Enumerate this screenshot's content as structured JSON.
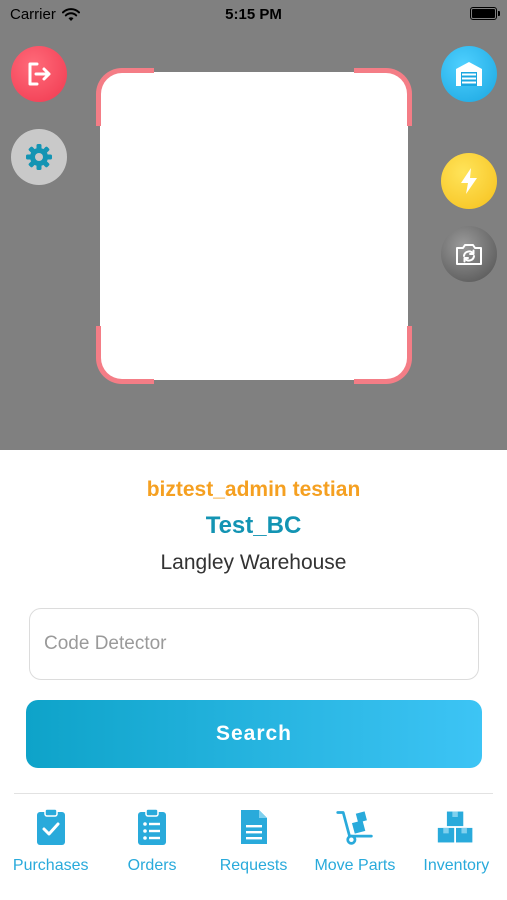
{
  "status_bar": {
    "carrier": "Carrier",
    "time": "5:15 PM"
  },
  "scanner": {
    "left_buttons": [
      {
        "icon": "logout-icon",
        "color": "#f0384f"
      },
      {
        "icon": "gear-icon",
        "color": "#c9c9c9"
      }
    ],
    "right_buttons": [
      {
        "icon": "warehouse-icon",
        "color": "#1aa6e0"
      },
      {
        "icon": "flash-icon",
        "color": "#f6c01c"
      },
      {
        "icon": "camera-switch-icon",
        "color": "#4f4f4f"
      }
    ],
    "frame_color": "#f47d86"
  },
  "info": {
    "user_name": "biztest_admin testian",
    "company": "Test_BC",
    "warehouse": "Langley Warehouse"
  },
  "code_input": {
    "placeholder": "Code Detector",
    "value": ""
  },
  "search_button": {
    "label": "Search"
  },
  "tabs": [
    {
      "label": "Purchases",
      "icon": "clipboard-check-icon"
    },
    {
      "label": "Orders",
      "icon": "list-icon"
    },
    {
      "label": "Requests",
      "icon": "document-icon"
    },
    {
      "label": "Move Parts",
      "icon": "hand-truck-icon"
    },
    {
      "label": "Inventory",
      "icon": "boxes-icon"
    }
  ],
  "colors": {
    "accent": "#29aadb",
    "user_name": "#f5a021",
    "company": "#1394b3"
  }
}
